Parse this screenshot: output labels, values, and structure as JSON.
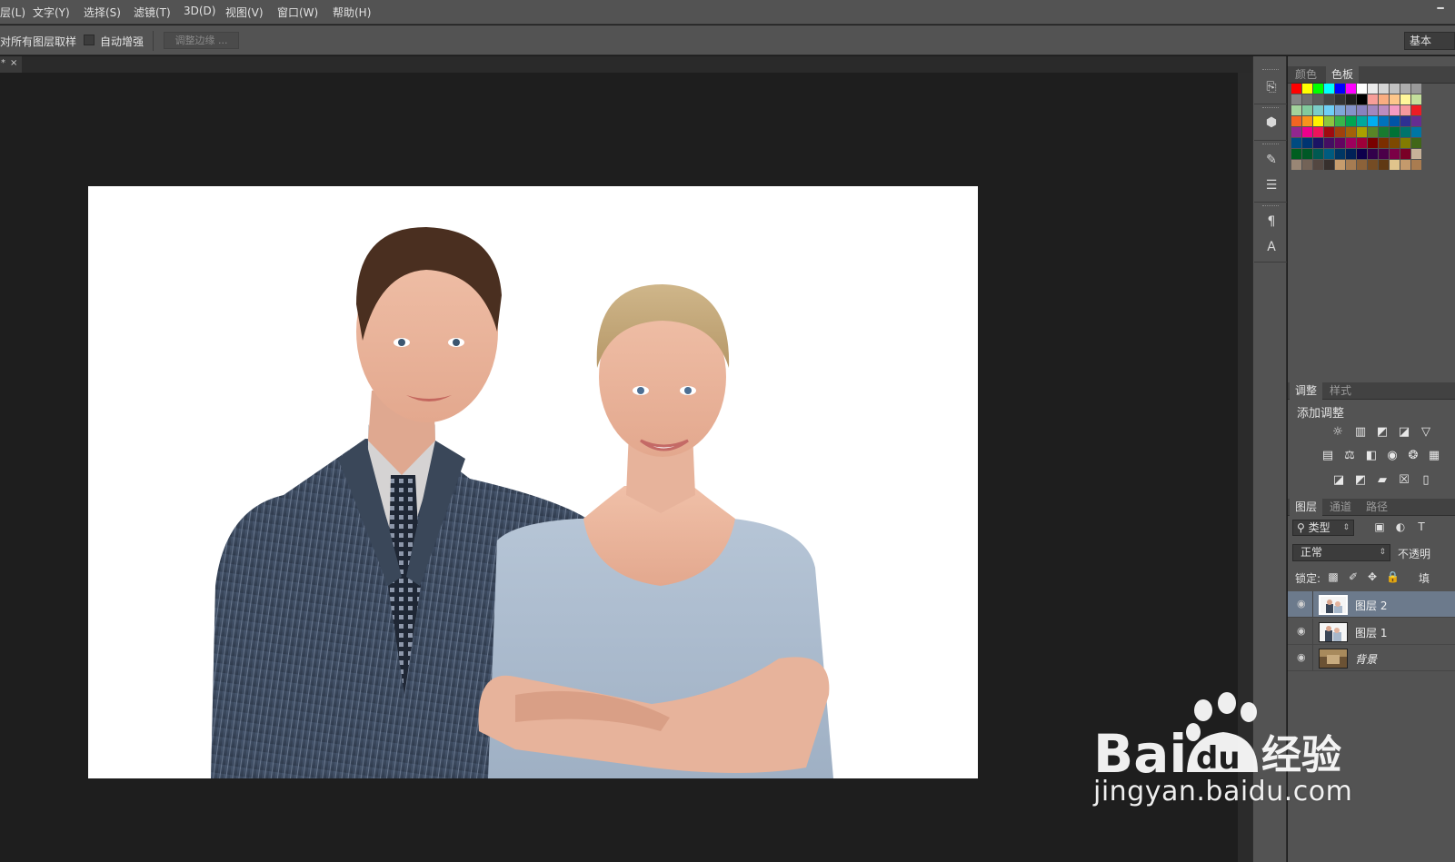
{
  "menu": {
    "items": [
      "层(L)",
      "文字(Y)",
      "选择(S)",
      "滤镜(T)",
      "3D(D)",
      "视图(V)",
      "窗口(W)",
      "帮助(H)"
    ],
    "minimize_glyph": "━"
  },
  "options": {
    "sample_all_layers": "对所有图层取样",
    "auto_enhance": "自动增强",
    "refine_edge": "调整边缘 ...",
    "workspace": "基本"
  },
  "document": {
    "tab_dot": "*",
    "tab_close": "×"
  },
  "panels": {
    "collapse_glyph": "◂◂",
    "color_tabs": [
      "颜色",
      "色板"
    ],
    "adjust_tabs": [
      "调整",
      "样式"
    ],
    "adjust_title": "添加调整",
    "layer_tabs": [
      "图层",
      "通道",
      "路径"
    ],
    "filter_kind": "类型",
    "blend_mode": "正常",
    "opacity_label": "不透明",
    "lock_label": "锁定:",
    "fill_label": "填",
    "layers": [
      {
        "name": "图层 2",
        "selected": true
      },
      {
        "name": "图层 1",
        "selected": false
      },
      {
        "name": "背景",
        "selected": false
      }
    ]
  },
  "swatch_colors": [
    [
      "#ff0000",
      "#ffff00",
      "#00ff00",
      "#00ffff",
      "#0000ff",
      "#ff00ff",
      "#ffffff",
      "#ebebeb",
      "#d6d6d6",
      "#c2c2c2",
      "#adadad",
      "#999999"
    ],
    [
      "#858585",
      "#707070",
      "#5c5c5c",
      "#474747",
      "#333333",
      "#1f1f1f",
      "#000000",
      "#f79e99",
      "#f9ad81",
      "#fdc68a",
      "#fff79a",
      "#c4df9b"
    ],
    [
      "#a3d39c",
      "#82ca9d",
      "#7bcdc8",
      "#6ecff6",
      "#7ea7d8",
      "#8493ca",
      "#8882be",
      "#a187be",
      "#bc8cbf",
      "#f49ac2",
      "#f6989d",
      "#ed1c24"
    ],
    [
      "#f26522",
      "#f7941d",
      "#fff200",
      "#8dc63f",
      "#39b54a",
      "#00a651",
      "#00a99d",
      "#00aeef",
      "#0072bc",
      "#0054a6",
      "#2e3192",
      "#662d91"
    ],
    [
      "#92278f",
      "#ec008c",
      "#ed145b",
      "#9e0b0f",
      "#a0410d",
      "#a36209",
      "#aba000",
      "#598527",
      "#197b30",
      "#007236",
      "#00746b",
      "#0076a3"
    ],
    [
      "#004b80",
      "#003471",
      "#1b1464",
      "#440e62",
      "#630460",
      "#9e005d",
      "#9e0039",
      "#790000",
      "#7b2e00",
      "#7d4900",
      "#827b00",
      "#406618"
    ],
    [
      "#005e20",
      "#005826",
      "#005952",
      "#005b7f",
      "#003663",
      "#002157",
      "#0d004c",
      "#32004b",
      "#4b0049",
      "#7b0046",
      "#7a0026",
      "#c7b299"
    ],
    [
      "#998675",
      "#736357",
      "#534741",
      "#37302d",
      "#c69c6d",
      "#a67c52",
      "#8c6239",
      "#754c24",
      "#603913",
      "#e0c48c",
      "#c49a6c",
      "#a97c50"
    ]
  ],
  "watermark": {
    "brand": "Bai",
    "brand_tail": "du",
    "product": "经验",
    "url": "jingyan.baidu.com"
  }
}
